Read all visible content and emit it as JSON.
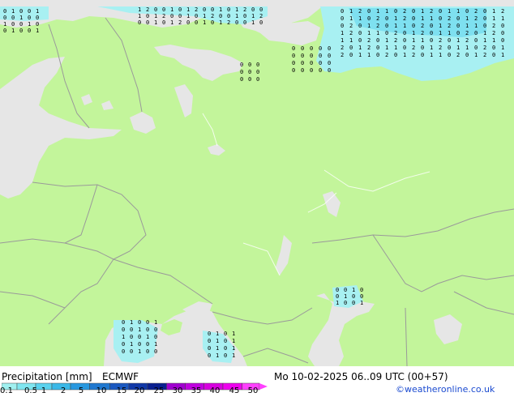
{
  "header": {
    "title": "Precipitation [mm]",
    "model": "ECMWF",
    "datetime": "Mo 10-02-2025 06..09 UTC (00+57)",
    "copyright": "©weatheronline.co.uk"
  },
  "legend": {
    "ticks": [
      "0.1",
      "0.5",
      "1",
      "2",
      "5",
      "10",
      "15",
      "20",
      "25",
      "30",
      "35",
      "40",
      "45",
      "50"
    ],
    "colors": [
      "#a0f0f0",
      "#80e6f0",
      "#5ad2ee",
      "#3ab8e8",
      "#2898e0",
      "#1f78d0",
      "#1a58c0",
      "#1038a8",
      "#0a2090",
      "#a000d0",
      "#c000e0",
      "#d800e0",
      "#ee00ee",
      "#ff40ff"
    ]
  },
  "map_colors": {
    "land": "#c3f59b",
    "sea": "#e6e6e6",
    "border": "#9a9a9a",
    "precip_light": "#a8f0f2",
    "precip_mid": "#7ee0f0"
  }
}
